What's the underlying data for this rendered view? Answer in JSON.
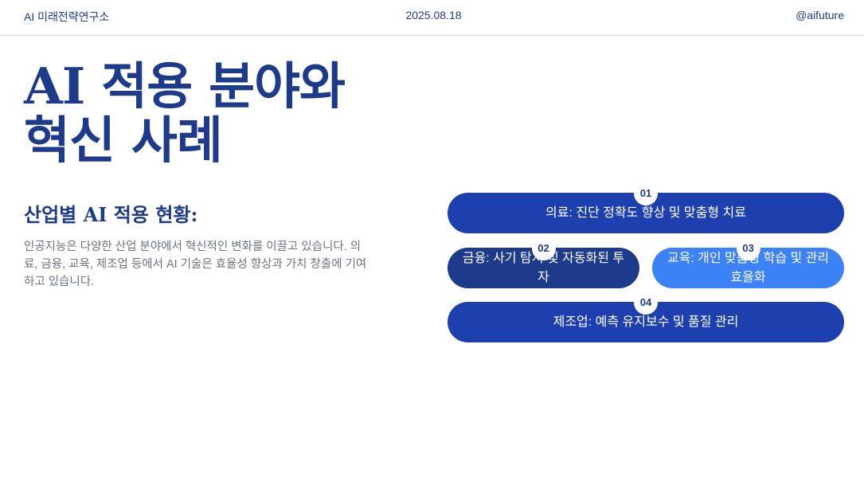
{
  "header": {
    "org": "AI 미래전략연구소",
    "date": "2025.08.18",
    "handle": "@aifuture"
  },
  "title": {
    "line1": "AI 적용 분야와",
    "line2": "혁신 사례"
  },
  "section": {
    "heading": "산업별 AI 적용 현황:",
    "description": "인공지능은 다양한 산업 분야에서 혁신적인 변화를 이끌고 있습니다. 의료, 금융, 교육, 제조업 등에서 AI 기술은 효율성 향상과 가치 창출에 기여하고 있습니다."
  },
  "items": [
    {
      "number": "01",
      "text": "의료: 진단 정확도 향상 및 맞춤형 치료",
      "color": "#1e40af"
    },
    {
      "number": "02",
      "text": "금융: 사기 탐지 및 자동화된 투자",
      "color": "#1e3a8a"
    },
    {
      "number": "03",
      "text": "교육: 개인 맞춤형 학습 및 관리 효율화",
      "color": "#3b82f6"
    },
    {
      "number": "04",
      "text": "제조업: 예측 유지보수 및 품질 관리",
      "color": "#1e40af"
    }
  ]
}
